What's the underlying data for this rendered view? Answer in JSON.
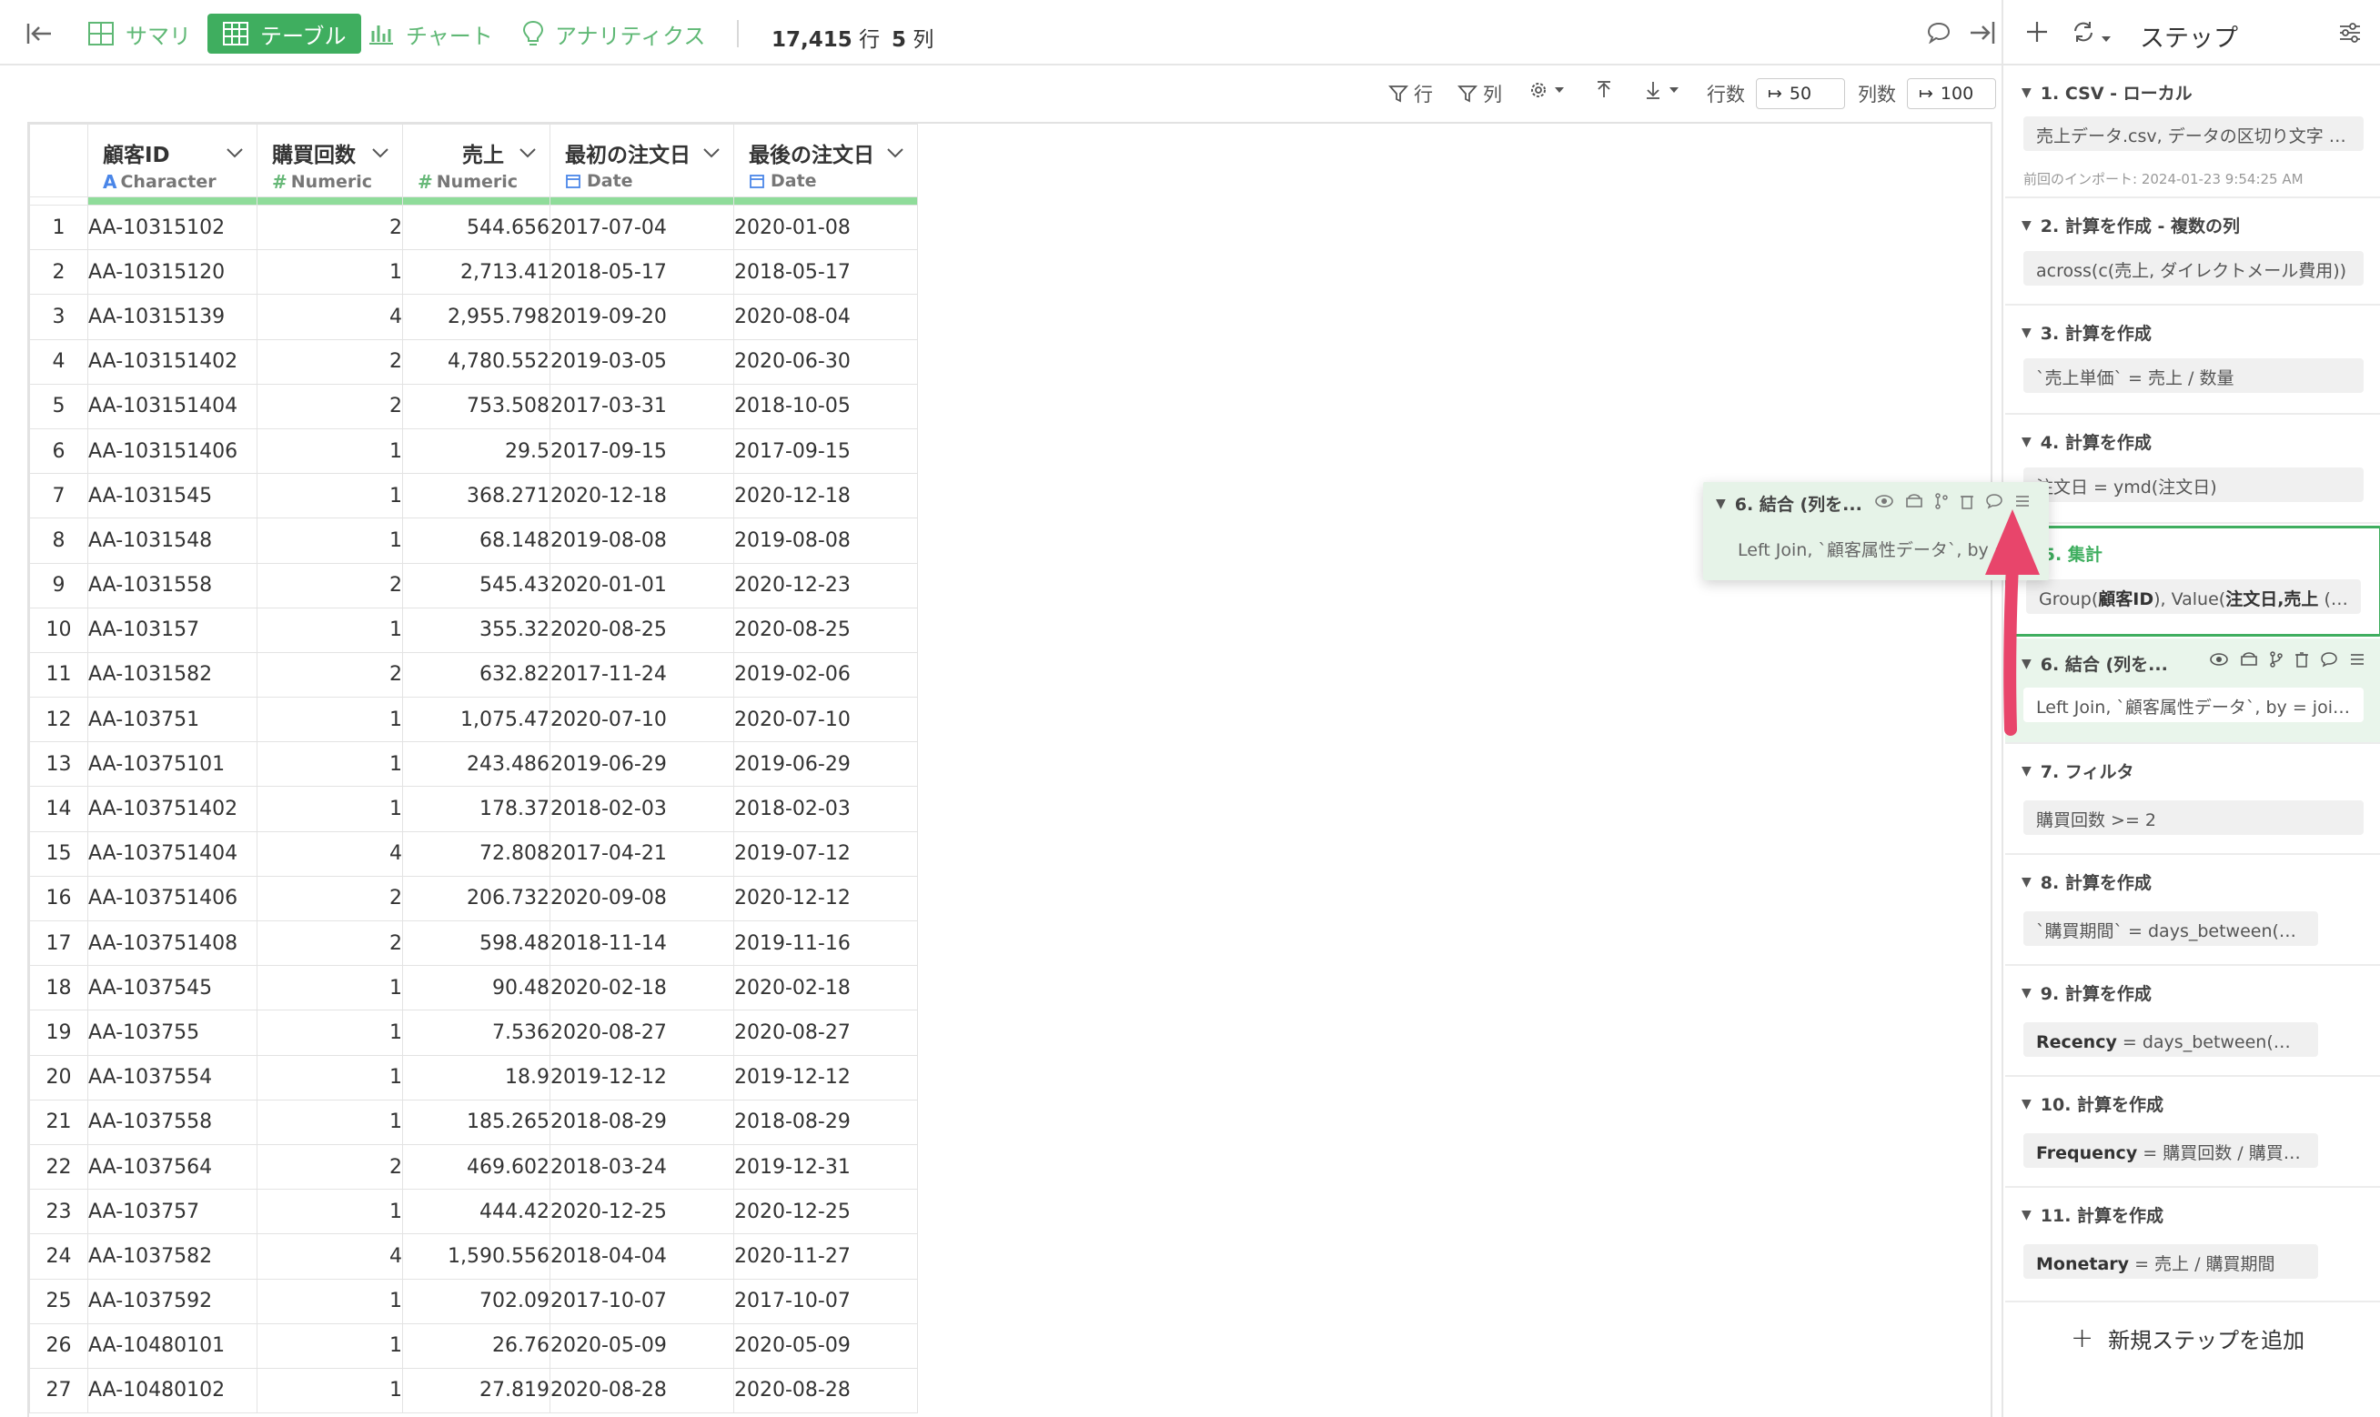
{
  "toolbar": {
    "summary_label": "サマリ",
    "table_label": "テーブル",
    "chart_label": "チャート",
    "analytics_label": "アナリティクス",
    "row_count": "17,415",
    "row_unit": "行",
    "col_count": "5",
    "col_unit": "列"
  },
  "subbar": {
    "filter_row": "行",
    "filter_col": "列",
    "rows_label": "行数",
    "rows_value": "50",
    "cols_label": "列数",
    "cols_value": "100"
  },
  "columns": [
    {
      "name": "顧客ID",
      "type": "Character",
      "type_icon": "A"
    },
    {
      "name": "購買回数",
      "type": "Numeric",
      "type_icon": "#"
    },
    {
      "name": "売上",
      "type": "Numeric",
      "type_icon": "#"
    },
    {
      "name": "最初の注文日",
      "type": "Date",
      "type_icon": "calendar-icon"
    },
    {
      "name": "最後の注文日",
      "type": "Date",
      "type_icon": "calendar-icon"
    }
  ],
  "rows": [
    [
      "1",
      "AA-10315102",
      "2",
      "544.656",
      "2017-07-04",
      "2020-01-08"
    ],
    [
      "2",
      "AA-10315120",
      "1",
      "2,713.41",
      "2018-05-17",
      "2018-05-17"
    ],
    [
      "3",
      "AA-10315139",
      "4",
      "2,955.798",
      "2019-09-20",
      "2020-08-04"
    ],
    [
      "4",
      "AA-103151402",
      "2",
      "4,780.552",
      "2019-03-05",
      "2020-06-30"
    ],
    [
      "5",
      "AA-103151404",
      "2",
      "753.508",
      "2017-03-31",
      "2018-10-05"
    ],
    [
      "6",
      "AA-103151406",
      "1",
      "29.5",
      "2017-09-15",
      "2017-09-15"
    ],
    [
      "7",
      "AA-1031545",
      "1",
      "368.271",
      "2020-12-18",
      "2020-12-18"
    ],
    [
      "8",
      "AA-1031548",
      "1",
      "68.148",
      "2019-08-08",
      "2019-08-08"
    ],
    [
      "9",
      "AA-1031558",
      "2",
      "545.43",
      "2020-01-01",
      "2020-12-23"
    ],
    [
      "10",
      "AA-103157",
      "1",
      "355.32",
      "2020-08-25",
      "2020-08-25"
    ],
    [
      "11",
      "AA-1031582",
      "2",
      "632.82",
      "2017-11-24",
      "2019-02-06"
    ],
    [
      "12",
      "AA-103751",
      "1",
      "1,075.47",
      "2020-07-10",
      "2020-07-10"
    ],
    [
      "13",
      "AA-10375101",
      "1",
      "243.486",
      "2019-06-29",
      "2019-06-29"
    ],
    [
      "14",
      "AA-103751402",
      "1",
      "178.37",
      "2018-02-03",
      "2018-02-03"
    ],
    [
      "15",
      "AA-103751404",
      "4",
      "72.808",
      "2017-04-21",
      "2019-07-12"
    ],
    [
      "16",
      "AA-103751406",
      "2",
      "206.732",
      "2020-09-08",
      "2020-12-12"
    ],
    [
      "17",
      "AA-103751408",
      "2",
      "598.48",
      "2018-11-14",
      "2019-11-16"
    ],
    [
      "18",
      "AA-1037545",
      "1",
      "90.48",
      "2020-02-18",
      "2020-02-18"
    ],
    [
      "19",
      "AA-103755",
      "1",
      "7.536",
      "2020-08-27",
      "2020-08-27"
    ],
    [
      "20",
      "AA-1037554",
      "1",
      "18.9",
      "2019-12-12",
      "2019-12-12"
    ],
    [
      "21",
      "AA-1037558",
      "1",
      "185.265",
      "2018-08-29",
      "2018-08-29"
    ],
    [
      "22",
      "AA-1037564",
      "2",
      "469.602",
      "2018-03-24",
      "2019-12-31"
    ],
    [
      "23",
      "AA-103757",
      "1",
      "444.42",
      "2020-12-25",
      "2020-12-25"
    ],
    [
      "24",
      "AA-1037582",
      "4",
      "1,590.556",
      "2018-04-04",
      "2020-11-27"
    ],
    [
      "25",
      "AA-1037592",
      "1",
      "702.09",
      "2017-10-07",
      "2017-10-07"
    ],
    [
      "26",
      "AA-10480101",
      "1",
      "26.76",
      "2020-05-09",
      "2020-05-09"
    ],
    [
      "27",
      "AA-10480102",
      "1",
      "27.819",
      "2020-08-28",
      "2020-08-28"
    ]
  ],
  "panel": {
    "title": "ステップ",
    "add_step": "新規ステップを追加",
    "steps": [
      {
        "title": "1. CSV - ローカル",
        "body": "売上データ.csv, データの区切り文字 = ,",
        "note": "前回のインポート: 2024-01-23 9:54:25 AM"
      },
      {
        "title": "2. 計算を作成 - 複数の列",
        "body": "across(c(売上, ダイレクトメール費用))"
      },
      {
        "title": "3. 計算を作成",
        "body": "`売上単価` = 売上 / 数量"
      },
      {
        "title": "4. 計算を作成",
        "body": "注文日 = ymd(注文日)"
      },
      {
        "title": "5. 集計",
        "body_bold1": "顧客ID",
        "body_bold2": "注文日,売上",
        "body_prefix": "Group(",
        "body_mid": "), Value(",
        "body_suffix": " (…"
      },
      {
        "title": "6. 結合 (列を...",
        "body": "Left Join, `顧客属性データ`, by = join_by(顧客ID)"
      },
      {
        "title": "7. フィルタ",
        "body": "購買回数 >= 2"
      },
      {
        "title": "8. 計算を作成",
        "body": "`購買期間` = days_between(最初の注文日, 最後の注文日)"
      },
      {
        "title": "9. 計算を作成",
        "body_bold": "Recency",
        "body": " = days_between(最後の注文日, today())"
      },
      {
        "title": "10. 計算を作成",
        "body_bold": "Frequency",
        "body": " = 購買回数 / 購買期間"
      },
      {
        "title": "11. 計算を作成",
        "body_bold": "Monetary",
        "body": " = 売上 / 購買期間"
      }
    ]
  },
  "float_card": {
    "title": "6. 結合 (列を...",
    "body": "Left Join, `顧客属性データ`, by ="
  },
  "colors": {
    "accent": "#3fae5f",
    "arrow": "#e8456b"
  }
}
